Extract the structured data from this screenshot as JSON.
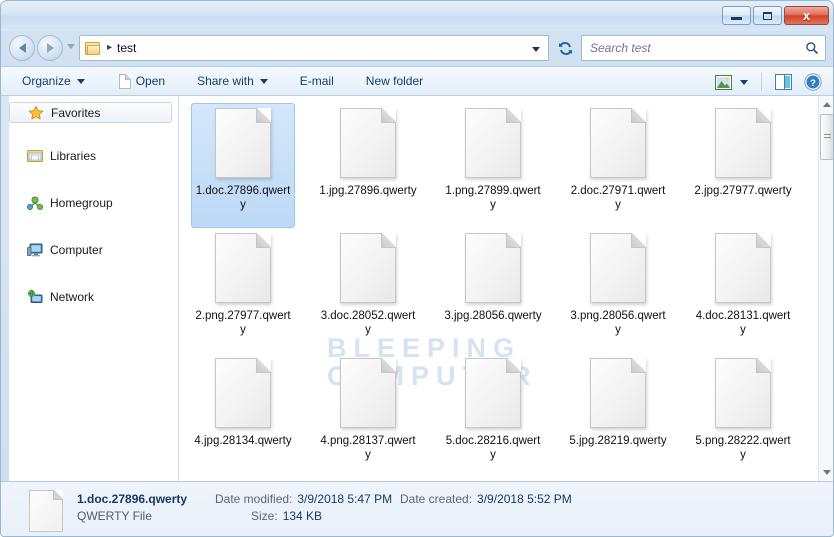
{
  "window": {
    "controls": {
      "minimize_label": "Minimize",
      "maximize_label": "Maximize",
      "close_label": "x"
    }
  },
  "address_bar": {
    "back_label": "Back",
    "forward_label": "Forward",
    "folder_icon": "folder-icon",
    "separator": "▸",
    "path": "test",
    "refresh_label": "Refresh"
  },
  "search": {
    "placeholder": "Search test",
    "value": "",
    "icon": "search-icon"
  },
  "toolbar": {
    "organize_label": "Organize",
    "open_label": "Open",
    "share_with_label": "Share with",
    "email_label": "E-mail",
    "new_folder_label": "New folder",
    "view_icon": "view-picture-icon",
    "preview_pane_icon": "preview-pane-icon",
    "help_icon": "help-icon"
  },
  "navpane": {
    "items": [
      {
        "label": "Favorites",
        "icon": "star-icon"
      },
      {
        "label": "Libraries",
        "icon": "libraries-icon"
      },
      {
        "label": "Homegroup",
        "icon": "homegroup-icon"
      },
      {
        "label": "Computer",
        "icon": "computer-icon"
      },
      {
        "label": "Network",
        "icon": "network-icon"
      }
    ]
  },
  "content": {
    "watermark_line1": "BLEEPING",
    "watermark_line2": "COMPUTER",
    "files": [
      {
        "name": "1.doc.27896.qwerty",
        "selected": true
      },
      {
        "name": "1.jpg.27896.qwerty",
        "selected": false
      },
      {
        "name": "1.png.27899.qwerty",
        "selected": false
      },
      {
        "name": "2.doc.27971.qwerty",
        "selected": false
      },
      {
        "name": "2.jpg.27977.qwerty",
        "selected": false
      },
      {
        "name": "2.png.27977.qwerty",
        "selected": false
      },
      {
        "name": "3.doc.28052.qwerty",
        "selected": false
      },
      {
        "name": "3.jpg.28056.qwerty",
        "selected": false
      },
      {
        "name": "3.png.28056.qwerty",
        "selected": false
      },
      {
        "name": "4.doc.28131.qwerty",
        "selected": false
      },
      {
        "name": "4.jpg.28134.qwerty",
        "selected": false
      },
      {
        "name": "4.png.28137.qwerty",
        "selected": false
      },
      {
        "name": "5.doc.28216.qwerty",
        "selected": false
      },
      {
        "name": "5.jpg.28219.qwerty",
        "selected": false
      },
      {
        "name": "5.png.28222.qwerty",
        "selected": false
      }
    ]
  },
  "scrollbar": {
    "up_label": "Scroll up",
    "down_label": "Scroll down"
  },
  "statusbar": {
    "file_name": "1.doc.27896.qwerty",
    "file_type": "QWERTY File",
    "date_modified_label": "Date modified:",
    "date_modified_value": "3/9/2018 5:47 PM",
    "size_label": "Size:",
    "size_value": "134 KB",
    "date_created_label": "Date created:",
    "date_created_value": "3/9/2018 5:52 PM"
  }
}
